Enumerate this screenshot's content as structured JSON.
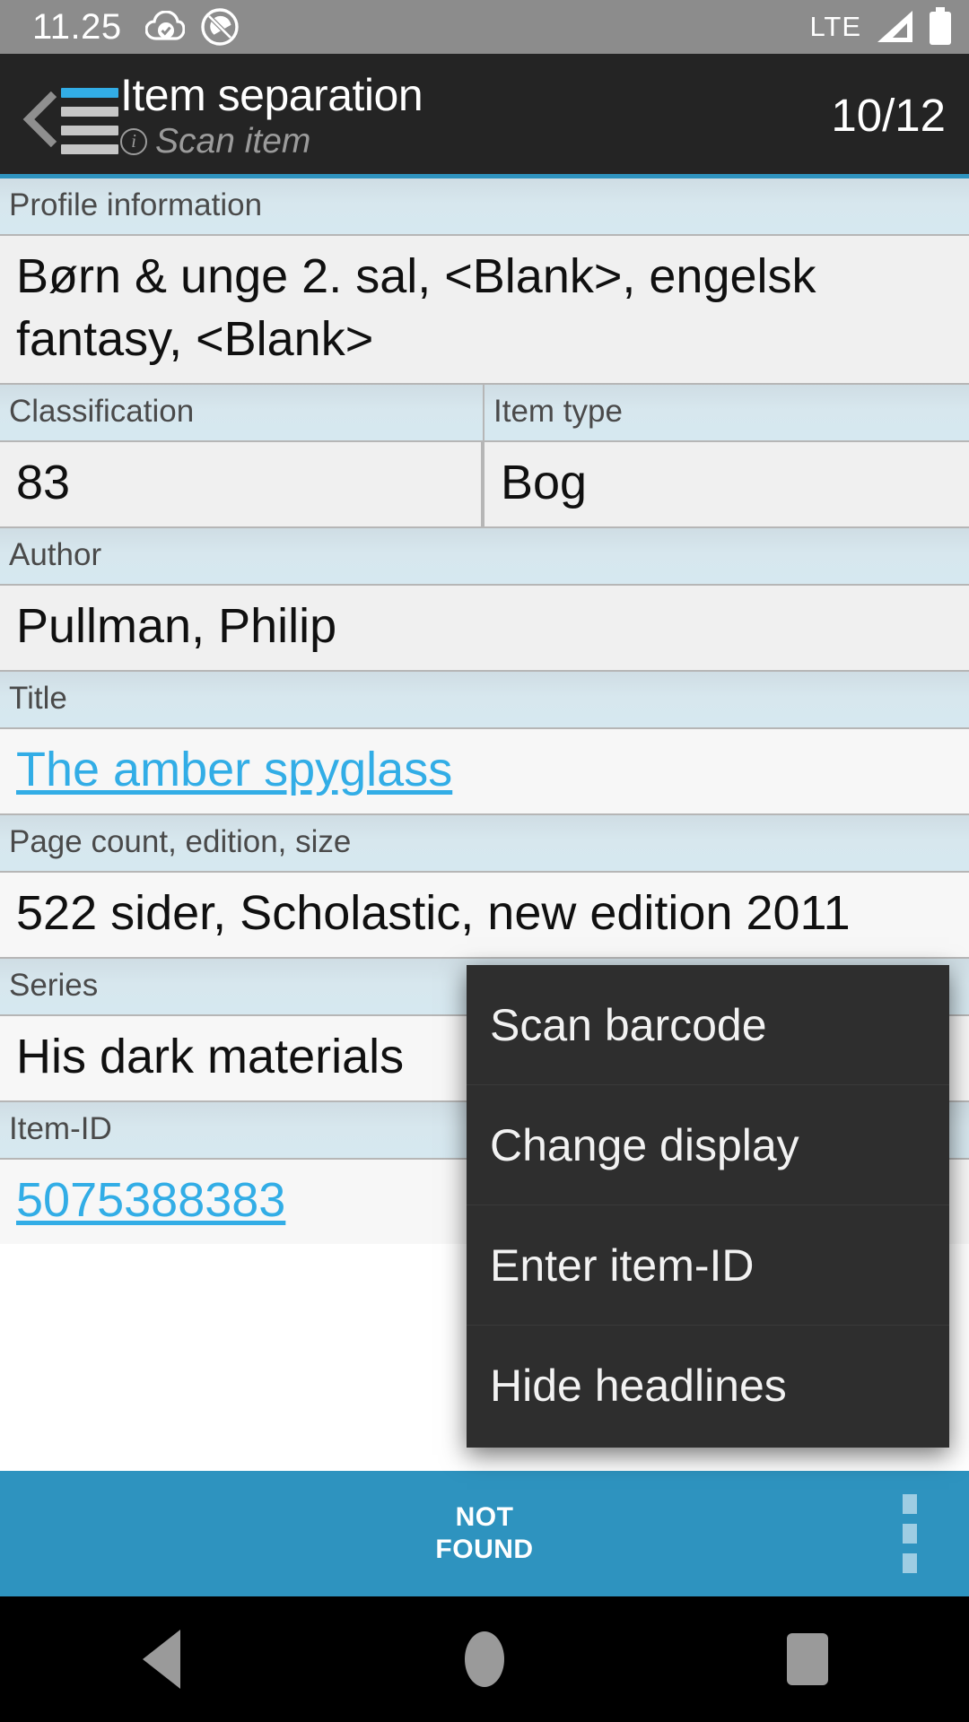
{
  "status_bar": {
    "time": "11.25",
    "network_label": "LTE",
    "icons": [
      "cloud-check-icon",
      "do-not-disturb-icon",
      "signal-icon",
      "battery-icon"
    ]
  },
  "app_bar": {
    "nav_icon": "back-list-icon",
    "title": "Item separation",
    "subtitle": "Scan item",
    "subtitle_icon": "info-icon",
    "counter": "10/12"
  },
  "fields": [
    {
      "label": "Profile information",
      "value": "Børn & unge 2. sal, <Blank>, engelsk fantasy, <Blank>",
      "type": "text"
    },
    {
      "label": "Classification",
      "value": "83",
      "type": "text",
      "column": "left"
    },
    {
      "label": "Item type",
      "value": "Bog",
      "type": "text",
      "column": "right"
    },
    {
      "label": "Author",
      "value": "Pullman, Philip",
      "type": "text"
    },
    {
      "label": "Title",
      "value": "The amber spyglass",
      "type": "link"
    },
    {
      "label": "Page count, edition, size",
      "value": "522 sider, Scholastic, new edition 2011",
      "type": "text"
    },
    {
      "label": "Series",
      "value": "His dark materials",
      "type": "text"
    },
    {
      "label": "Item-ID",
      "value": "5075388383",
      "type": "link"
    }
  ],
  "popup_menu": {
    "items": [
      {
        "label": "Scan barcode"
      },
      {
        "label": "Change display"
      },
      {
        "label": "Enter item-ID"
      },
      {
        "label": "Hide headlines"
      }
    ]
  },
  "bottom_bar": {
    "primary_label_line1": "NOT",
    "primary_label_line2": "FOUND",
    "overflow_icon": "overflow-menu-icon"
  },
  "nav_bar": {
    "back": "back-icon",
    "home": "home-icon",
    "recents": "recents-icon"
  },
  "colors": {
    "accent": "#32ade6",
    "action_bar": "#2e93bf",
    "app_bar": "#242424",
    "status_bar": "#8c8c8c",
    "header_row": "#d6e8f0",
    "menu_bg": "#2e2e2e"
  }
}
